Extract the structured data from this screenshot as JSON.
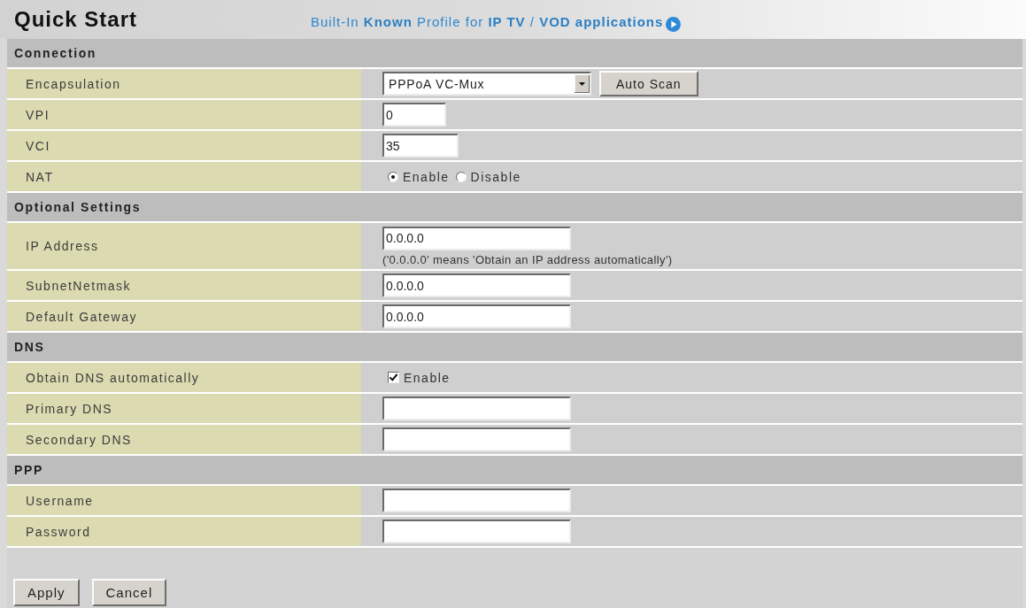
{
  "header": {
    "title": "Quick Start",
    "profile_link": "Built-In **Known** Profile for **IP TV** / **VOD applications**"
  },
  "sections": [
    {
      "title": "Connection",
      "rows": [
        {
          "kind": "select",
          "label": "Encapsulation",
          "value": "PPPoA VC-Mux",
          "button": "Auto Scan"
        },
        {
          "kind": "short",
          "label": "VPI",
          "value": "0"
        },
        {
          "kind": "short",
          "label": "VCI",
          "value": "35"
        },
        {
          "kind": "radio",
          "label": "NAT",
          "options": [
            {
              "label": "Enable",
              "selected": true
            },
            {
              "label": "Disable",
              "selected": false
            }
          ]
        }
      ]
    },
    {
      "title": "Optional Settings",
      "rows": [
        {
          "kind": "text",
          "label": "IP Address",
          "value": "0.0.0.0",
          "note": "('0.0.0.0' means 'Obtain an IP address automatically')"
        },
        {
          "kind": "text",
          "label": "SubnetNetmask",
          "value": "0.0.0.0"
        },
        {
          "kind": "text",
          "label": "Default Gateway",
          "value": "0.0.0.0"
        }
      ]
    },
    {
      "title": "DNS",
      "rows": [
        {
          "kind": "checkbox",
          "label": "Obtain DNS automatically",
          "option": "Enable",
          "checked": true
        },
        {
          "kind": "text",
          "label": "Primary DNS"
        },
        {
          "kind": "text",
          "label": "Secondary DNS"
        }
      ]
    },
    {
      "title": "PPP",
      "rows": [
        {
          "kind": "text",
          "label": "Username"
        },
        {
          "kind": "password",
          "label": "Password"
        }
      ]
    }
  ],
  "buttons": [
    "Apply",
    "Cancel"
  ]
}
